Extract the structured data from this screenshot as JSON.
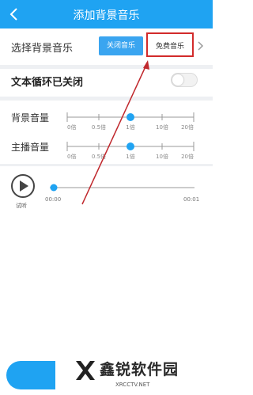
{
  "header": {
    "title": "添加背景音乐"
  },
  "music_select": {
    "label": "选择背景音乐",
    "close_label": "关闭音乐",
    "free_label": "免费音乐"
  },
  "loop": {
    "label": "文本循环已关闭",
    "enabled": false
  },
  "scale_labels": [
    "0倍",
    "0.5倍",
    "1倍",
    "10倍",
    "20倍"
  ],
  "background_volume": {
    "label": "背景音量",
    "value": "1倍"
  },
  "host_volume": {
    "label": "主播音量",
    "value": "1倍"
  },
  "player": {
    "play_label": "试听",
    "current_time": "00:00",
    "total_time": "00:01",
    "progress": 0
  },
  "watermark": {
    "brand": "鑫锐软件园",
    "url": "XRCCTV.NET"
  },
  "colors": {
    "accent": "#1fa3f2",
    "highlight_box": "#d22b2b",
    "arrow": "#c0282d"
  }
}
